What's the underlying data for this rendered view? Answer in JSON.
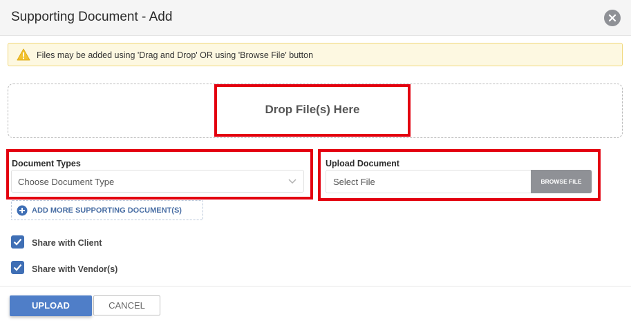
{
  "dialog": {
    "title": "Supporting Document - Add"
  },
  "notice": {
    "text": "Files may be added using 'Drag and Drop' OR using 'Browse File' button",
    "icon": "warning-icon"
  },
  "dropzone": {
    "text": "Drop File(s) Here"
  },
  "document_types": {
    "label": "Document Types",
    "placeholder": "Choose Document Type"
  },
  "upload_document": {
    "label": "Upload Document",
    "placeholder": "Select File",
    "browse_label": "BROWSE FILE"
  },
  "add_more": {
    "label": "ADD MORE SUPPORTING DOCUMENT(S)"
  },
  "checkboxes": [
    {
      "label": "Share with Client",
      "checked": true
    },
    {
      "label": "Share with Vendor(s)",
      "checked": true
    }
  ],
  "footer": {
    "upload_label": "UPLOAD",
    "cancel_label": "CANCEL"
  },
  "colors": {
    "accent": "#4f7ec8",
    "highlight": "#e3000f",
    "warning": "#f2c230"
  }
}
